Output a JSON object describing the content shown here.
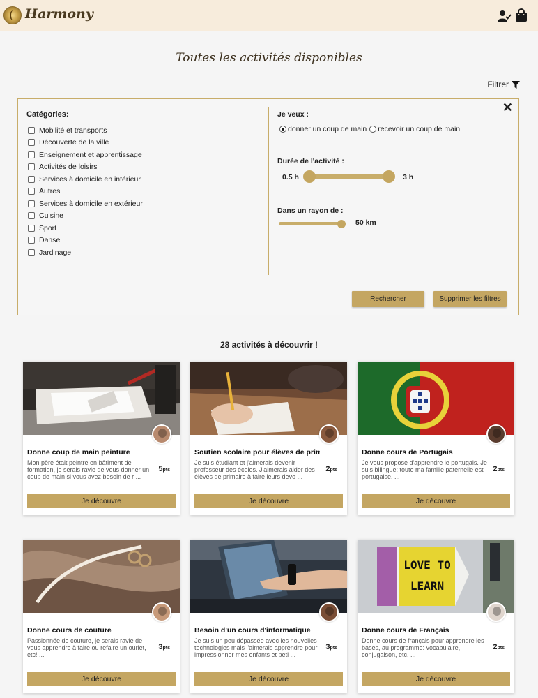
{
  "header": {
    "app_name": "Harmony",
    "icons": [
      "user-check-icon",
      "shopping-bag-icon"
    ]
  },
  "page": {
    "title": "Toutes les activités disponibles"
  },
  "filter_toggle": {
    "label": "Filtrer",
    "icon": "filter-funnel-icon"
  },
  "filters": {
    "close_icon": "close-icon",
    "categories_title": "Catégories:",
    "categories": [
      "Mobilité et transports",
      "Découverte de la ville",
      "Enseignement et apprentissage",
      "Activités de loisirs",
      "Services à domicile en intérieur",
      "Autres",
      "Services à domicile en extérieur",
      "Cuisine",
      "Sport",
      "Danse",
      "Jardinage"
    ],
    "want_label": "Je veux :",
    "want_options": [
      {
        "label": "donner un coup de main",
        "selected": true
      },
      {
        "label": "recevoir un coup de main",
        "selected": false
      }
    ],
    "duration_label": "Durée de l'activité :",
    "duration_min": "0.5 h",
    "duration_max": "3 h",
    "radius_label": "Dans un rayon de :",
    "radius_value": "50 km",
    "search_button": "Rechercher",
    "clear_button": "Supprimer les filtres"
  },
  "results": {
    "count_text": "28 activités à découvrir !"
  },
  "cards": [
    {
      "title": "Donne coup de main peinture",
      "description": "Mon père était peintre en bâtiment de formation, je serais ravie de vous donner un coup de main si vous avez besoin de r ...",
      "points": "5",
      "points_unit": "pts",
      "button": "Je découvre"
    },
    {
      "title": "Soutien scolaire pour élèves de primaire",
      "description": "Je suis étudiant et j'aimerais devenir professeur des écoles. J'aimerais aider des élèves de primaire à faire leurs devo ...",
      "points": "2",
      "points_unit": "pts",
      "button": "Je découvre"
    },
    {
      "title": "Donne cours de Portugais",
      "description": "Je vous propose d'apprendre le portugais. Je suis bilingue: toute ma famille paternelle est portugaise. ...",
      "points": "2",
      "points_unit": "pts",
      "button": "Je découvre"
    },
    {
      "title": "Donne cours de couture",
      "description": "Passionnée de couture, je serais ravie de vous apprendre à faire ou refaire un ourlet, etc! ...",
      "points": "3",
      "points_unit": "pts",
      "button": "Je découvre"
    },
    {
      "title": "Besoin d'un cours d'informatique",
      "description": "Je suis un peu dépassée avec les nouvelles technologies mais j'aimerais apprendre pour impressionner mes enfants et peti ...",
      "points": "3",
      "points_unit": "pts",
      "button": "Je découvre"
    },
    {
      "title": "Donne cours de Français",
      "description": "Donne cours de français pour apprendre les bases, au programme: vocabulaire, conjugaison, etc. ...",
      "points": "2",
      "points_unit": "pts",
      "button": "Je découvre"
    }
  ],
  "card_image_texts": {
    "learn_sign": "LOVE TO LEARN"
  }
}
